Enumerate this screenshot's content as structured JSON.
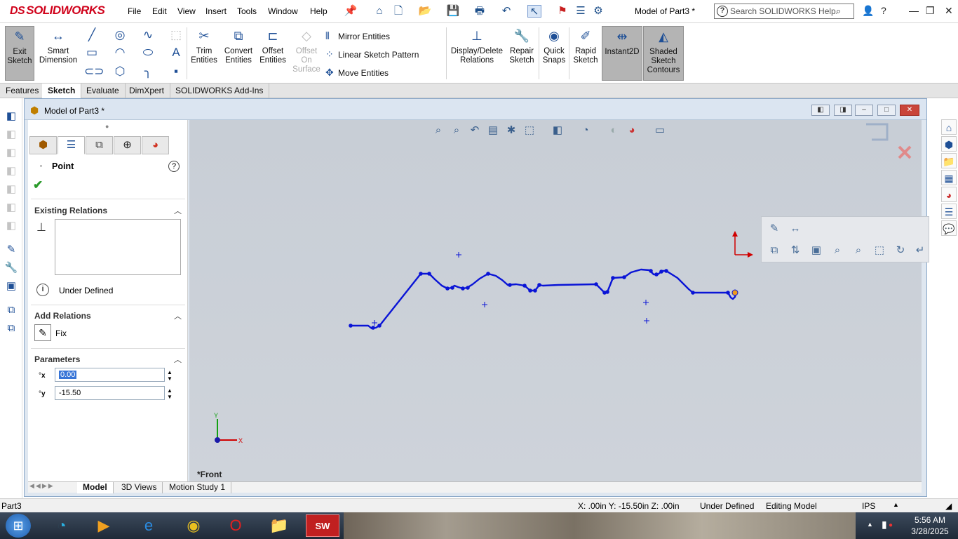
{
  "app": {
    "logo": "SOLIDWORKS",
    "doc_title": "Model of Part3 *"
  },
  "menu": [
    "File",
    "Edit",
    "View",
    "Insert",
    "Tools",
    "Window",
    "Help"
  ],
  "help_search": {
    "placeholder": "Search SOLIDWORKS Help"
  },
  "command_manager": {
    "exit_sketch": "Exit Sketch",
    "smart_dimension": "Smart Dimension",
    "trim_entities": "Trim Entities",
    "convert_entities": "Convert Entities",
    "offset_entities": "Offset Entities",
    "offset_on_surface": "Offset On Surface",
    "mirror_entities": "Mirror Entities",
    "linear_sketch_pattern": "Linear Sketch Pattern",
    "move_entities": "Move Entities",
    "display_delete_relations": "Display/Delete Relations",
    "repair_sketch": "Repair Sketch",
    "quick_snaps": "Quick Snaps",
    "rapid_sketch": "Rapid Sketch",
    "instant2d": "Instant2D",
    "shaded_sketch_contours": "Shaded Sketch Contours"
  },
  "tabs": [
    "Features",
    "Sketch",
    "Evaluate",
    "DimXpert",
    "SOLIDWORKS Add-Ins"
  ],
  "active_tab": "Sketch",
  "property_manager": {
    "title": "Point",
    "existing_relations": "Existing Relations",
    "status": "Under Defined",
    "add_relations": "Add Relations",
    "fix": "Fix",
    "parameters": "Parameters",
    "x_value": "0.00",
    "y_value": "-15.50"
  },
  "view_label": "*Front",
  "bottom_tabs": [
    "Model",
    "3D Views",
    "Motion Study 1"
  ],
  "status_bar": {
    "part": "Part3",
    "coords": "X: .00in Y: -15.50in Z: .00in",
    "definition": "Under Defined",
    "mode": "Editing Model",
    "units": "IPS"
  },
  "clock": {
    "time": "5:56 AM",
    "date": "3/28/2025"
  },
  "colors": {
    "sketch": "#0a14d6",
    "selected_point": "#f09a1a",
    "axis_x": "#d00000",
    "axis_y": "#12a012"
  }
}
